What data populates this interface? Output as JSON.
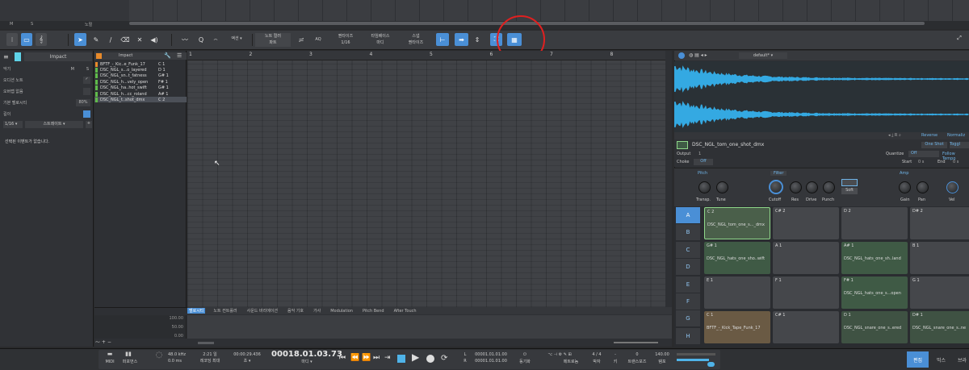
{
  "top": {
    "m": "M",
    "s": "S",
    "track": "노멀"
  },
  "toolbar": {
    "action": "액션",
    "note_color_l1": "노트 컬러",
    "note_color_l2": "파트",
    "aq": "AQ",
    "quantize_l1": "퀀타이즈",
    "quantize_l2": "1/16",
    "timebase_l1": "타임베이스",
    "timebase_l2": "마디",
    "snap_l1": "스냅",
    "snap_l2": "퀀타이즈"
  },
  "inspector": {
    "instrument": "Impact",
    "rows": [
      {
        "label": "악기",
        "a": "M",
        "b": "S"
      },
      {
        "label": "오디션 노트",
        "value": "✓"
      },
      {
        "label": "오버랩 없음",
        "value": ""
      },
      {
        "label": "기본 벨로시티",
        "value": "80%"
      },
      {
        "label": "길이",
        "value": ""
      }
    ],
    "length_value": "1/16",
    "scale": "스트레이트",
    "empty": "선택된 이벤트가 없습니다."
  },
  "tracklist": {
    "title": "Impact",
    "tracks": [
      {
        "name": "BFTF_-_Kic..e_Funk_17",
        "note": "C 1"
      },
      {
        "name": "DSC_NGL_s...o_layered",
        "note": "D 1"
      },
      {
        "name": "DSC_NGL_sn..t_fatness",
        "note": "G# 1"
      },
      {
        "name": "DSC_NGL_h...vely_open",
        "note": "F# 1"
      },
      {
        "name": "DSC_NGL_ha..hot_swift",
        "note": "G# 1"
      },
      {
        "name": "DSC_NGL_h...cc_roland",
        "note": "A# 1"
      },
      {
        "name": "DSC_NGL_t..shot_dmx",
        "note": "C 2"
      }
    ]
  },
  "ruler": [
    "1",
    "2",
    "3",
    "4",
    "5",
    "6",
    "7",
    "8"
  ],
  "lanes": {
    "tabs": [
      "벨로시티",
      "노트 컨트롤러",
      "사운드 바리에이션",
      "음악 기호",
      "가사",
      "Modulation",
      "Pitch Bend",
      "After Touch"
    ],
    "scale": [
      "100.00",
      "50.00",
      "0.00"
    ]
  },
  "instrument": {
    "preset": "default*",
    "reverse": "Reverse",
    "normalize": "Normaliz",
    "sample_name": "DSC_NGL_tom_one_shot_dmx",
    "output_label": "Output",
    "output_value": "1",
    "choke_label": "Choke",
    "choke_value": "Off",
    "oneshot": "One Shot",
    "toggle": "Toggl",
    "quantize_label": "Quantize",
    "quantize_value": "Off",
    "follow_tempo": "Follow Tempo",
    "start_label": "Start",
    "start_value": "0 s",
    "end_label": "End",
    "end_value": "0 s",
    "groups": {
      "pitch": "Pitch",
      "filter": "Filter",
      "amp": "Amp"
    },
    "knobs": {
      "transp": "Transp.",
      "tune": "Tune",
      "cutoff": "Cutoff",
      "res": "Res",
      "drive": "Drive",
      "punch": "Punch",
      "soft": "Soft",
      "gain": "Gain",
      "pan": "Pan",
      "vel": "Vel"
    },
    "banks": [
      "A",
      "B",
      "C",
      "D",
      "E",
      "F",
      "G",
      "H"
    ],
    "pads": [
      {
        "note": "C 2",
        "name": "DSC_NGL_tom_one_s..._dmx",
        "style": "sel"
      },
      {
        "note": "C# 2",
        "name": "",
        "style": ""
      },
      {
        "note": "D 2",
        "name": "",
        "style": ""
      },
      {
        "note": "D# 2",
        "name": "",
        "style": ""
      },
      {
        "note": "G# 1",
        "name": "DSC_NGL_hats_one_sho..wift",
        "style": "green"
      },
      {
        "note": "A 1",
        "name": "",
        "style": ""
      },
      {
        "note": "A# 1",
        "name": "DSC_NGL_hats_one_sh..land",
        "style": "green"
      },
      {
        "note": "B 1",
        "name": "",
        "style": ""
      },
      {
        "note": "E 1",
        "name": "",
        "style": ""
      },
      {
        "note": "F 1",
        "name": "",
        "style": ""
      },
      {
        "note": "F# 1",
        "name": "DSC_NGL_hats_one_s...open",
        "style": "green"
      },
      {
        "note": "G 1",
        "name": "",
        "style": ""
      },
      {
        "note": "C 1",
        "name": "BFTF_-_Kick_Tape_Funk_17",
        "style": "orange"
      },
      {
        "note": "C# 1",
        "name": "",
        "style": ""
      },
      {
        "note": "D 1",
        "name": "DSC_NGL_snare_one_s..ered",
        "style": "olive"
      },
      {
        "note": "D# 1",
        "name": "DSC_NGL_snare_one_s..ne",
        "style": "olive"
      }
    ]
  },
  "transport": {
    "midi": "MIDI",
    "perf": "퍼포먼스",
    "khz": "48.0 kHz",
    "ms": "0.0 ms",
    "days": "2:21 일",
    "rec_max": "레코딩 최대",
    "time": "00:00:29.436",
    "time_unit": "초",
    "position": "00018.01.03.73",
    "position_unit": "마디",
    "L": "L",
    "R": "R",
    "loop_l": "00001.01.01.00",
    "loop_r": "00001.01.01.00",
    "sync": "동기화",
    "metronome": "메트로놈",
    "sig": "4 / 4",
    "sig_label": "박자",
    "key": "-",
    "key_label": "키",
    "transpose": "0",
    "transpose_label": "트랜스포즈",
    "tempo": "140.00",
    "tempo_label": "템포"
  },
  "tabs": {
    "edit": "편집",
    "mix": "믹스",
    "browse": "브라"
  }
}
